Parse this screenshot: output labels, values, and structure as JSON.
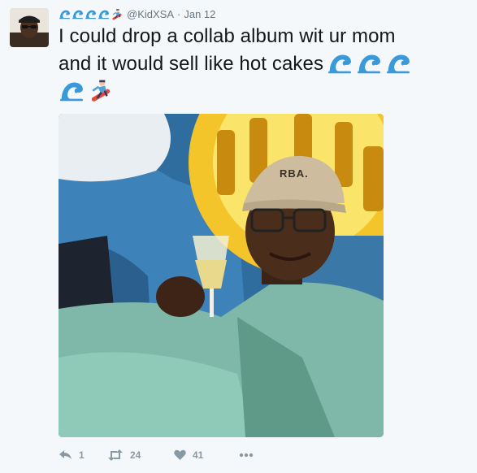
{
  "tweet": {
    "user": {
      "name_emojis": [
        "wave-emoji",
        "wave-emoji",
        "wave-emoji",
        "wave-emoji",
        "snowboarder-emoji"
      ],
      "handle": "@KidXSA",
      "separator": "·",
      "date": "Jan 12"
    },
    "text": {
      "line1": "I could drop a collab album wit ur mom",
      "line2": "and it would sell like hot cakes"
    },
    "text_emojis": [
      "wave-emoji",
      "wave-emoji",
      "wave-emoji",
      "wave-emoji",
      "snowboarder-emoji"
    ],
    "photo": {
      "cap_text": "RBA."
    },
    "actions": {
      "reply_count": "1",
      "retweet_count": "24",
      "like_count": "41"
    }
  },
  "colors": {
    "background": "#f5f8fa",
    "text": "#14171a",
    "meta": "#657786",
    "action": "#8899a6",
    "wave": "#2b8fd6"
  }
}
